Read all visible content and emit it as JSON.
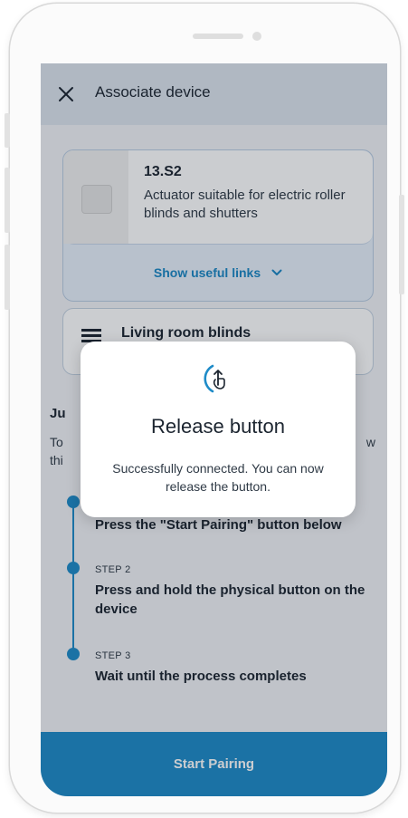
{
  "appbar": {
    "title": "Associate device",
    "close_icon": "close-icon"
  },
  "device": {
    "name": "13.S2",
    "description": "Actuator suitable for electric roller blinds and shutters",
    "links_label": "Show useful links",
    "links_icon": "chevron-down-icon"
  },
  "room": {
    "name": "Living room blinds",
    "icon": "blinds-icon"
  },
  "intro": {
    "title": "Ju",
    "desc_line1_start": "To",
    "desc_line1_end": "w",
    "desc_line2_start": "thi"
  },
  "steps": [
    {
      "label": "",
      "text": "Press the \"Start Pairing\" button below"
    },
    {
      "label": "STEP 2",
      "text": "Press and hold the physical button on the device"
    },
    {
      "label": "STEP 3",
      "text": "Wait until the process completes"
    }
  ],
  "footer": {
    "button_label": "Start Pairing"
  },
  "dialog": {
    "icon": "release-touch-icon",
    "title": "Release button",
    "message": "Successfully connected. You can now release the button."
  },
  "colors": {
    "accent": "#1e8bc8",
    "appbar": "#dde5ee",
    "card_border": "#b9cce2"
  }
}
